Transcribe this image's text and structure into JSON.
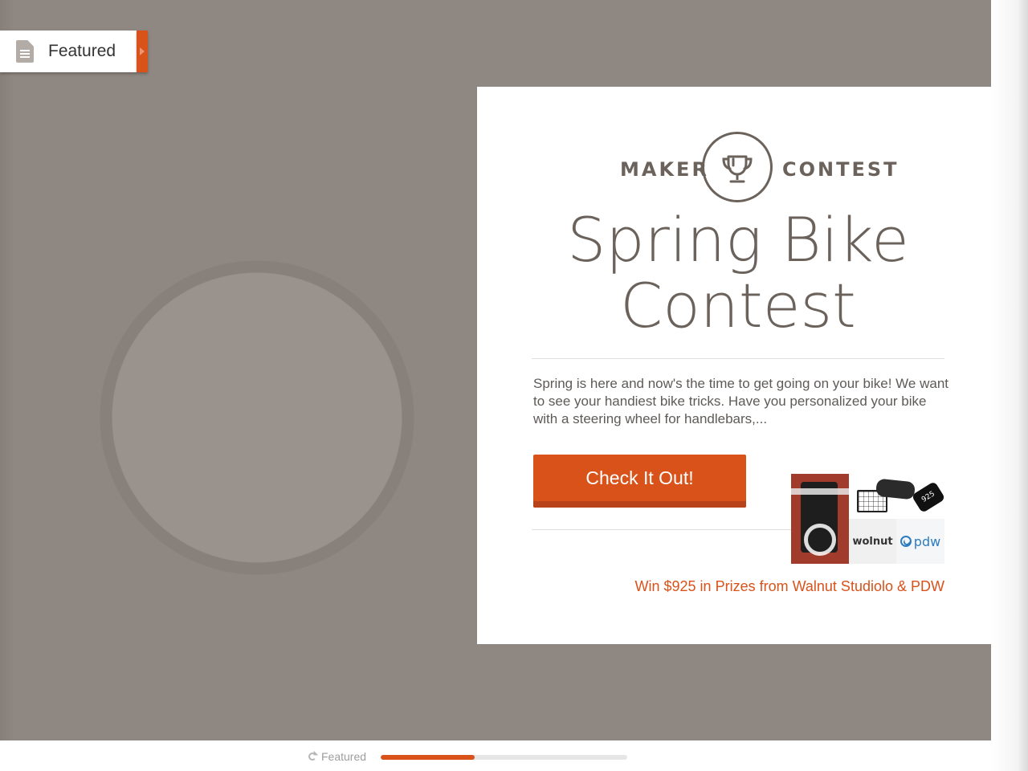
{
  "featured_tab": {
    "label": "Featured",
    "icon": "document-icon"
  },
  "card": {
    "badge": {
      "left": "MAKER",
      "right": "CONTEST",
      "icon": "trophy-icon"
    },
    "title_lines": [
      "Spring Bike",
      "Contest"
    ],
    "description": "Spring is here and now's the time to get going on your bike! We want to see your handiest bike tricks. Have you personalized your bike with a steering wheel for handlebars,...",
    "cta_label": "Check It Out!",
    "prizes": {
      "walnut_logo_text": "wolnut",
      "pdw_logo_text": "pdw",
      "tag_text": "925",
      "prize_text": "Win $925 in Prizes from Walnut Studiolo & PDW"
    }
  },
  "bottom_bar": {
    "label": "Featured",
    "icon": "refresh-icon",
    "progress_fraction": 0.38
  },
  "colors": {
    "accent": "#d9521a",
    "text_brown": "#6b625b",
    "hero_gray": "#8f8781"
  }
}
